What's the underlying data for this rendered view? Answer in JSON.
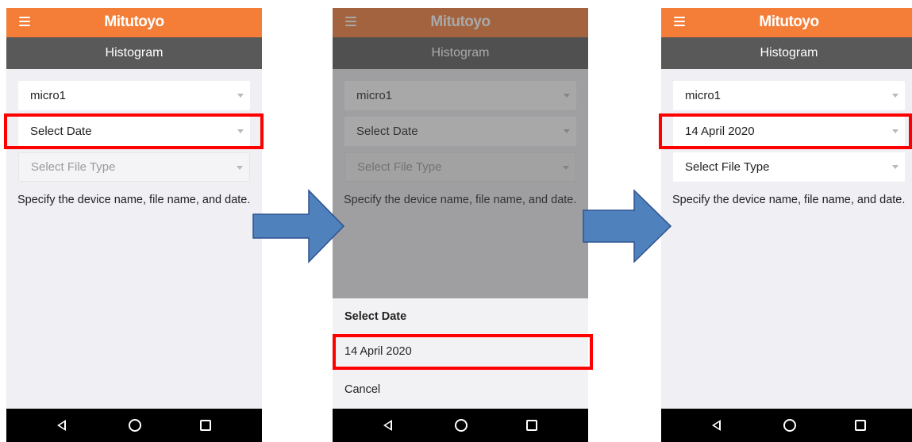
{
  "app": {
    "brand": "Mitutoyo",
    "screen_title": "Histogram",
    "hint": "Specify the device name, file name, and date."
  },
  "step1": {
    "device_value": "micro1",
    "date_placeholder": "Select Date",
    "file_type_placeholder": "Select File Type"
  },
  "step2": {
    "device_value": "micro1",
    "date_placeholder": "Select Date",
    "file_type_placeholder": "Select File Type",
    "sheet_title": "Select Date",
    "sheet_option": "14 April 2020",
    "sheet_cancel": "Cancel"
  },
  "step3": {
    "device_value": "micro1",
    "date_value": "14 April 2020",
    "file_type_placeholder": "Select File Type"
  },
  "colors": {
    "appbar": "#f47e37",
    "titlebar": "#595959",
    "highlight": "#ff0000",
    "arrow": "#4f81bd"
  },
  "icons": [
    "menu-icon",
    "nav-back-icon",
    "nav-home-icon",
    "nav-recent-icon",
    "chevron-down-icon",
    "arrow-right-icon"
  ]
}
